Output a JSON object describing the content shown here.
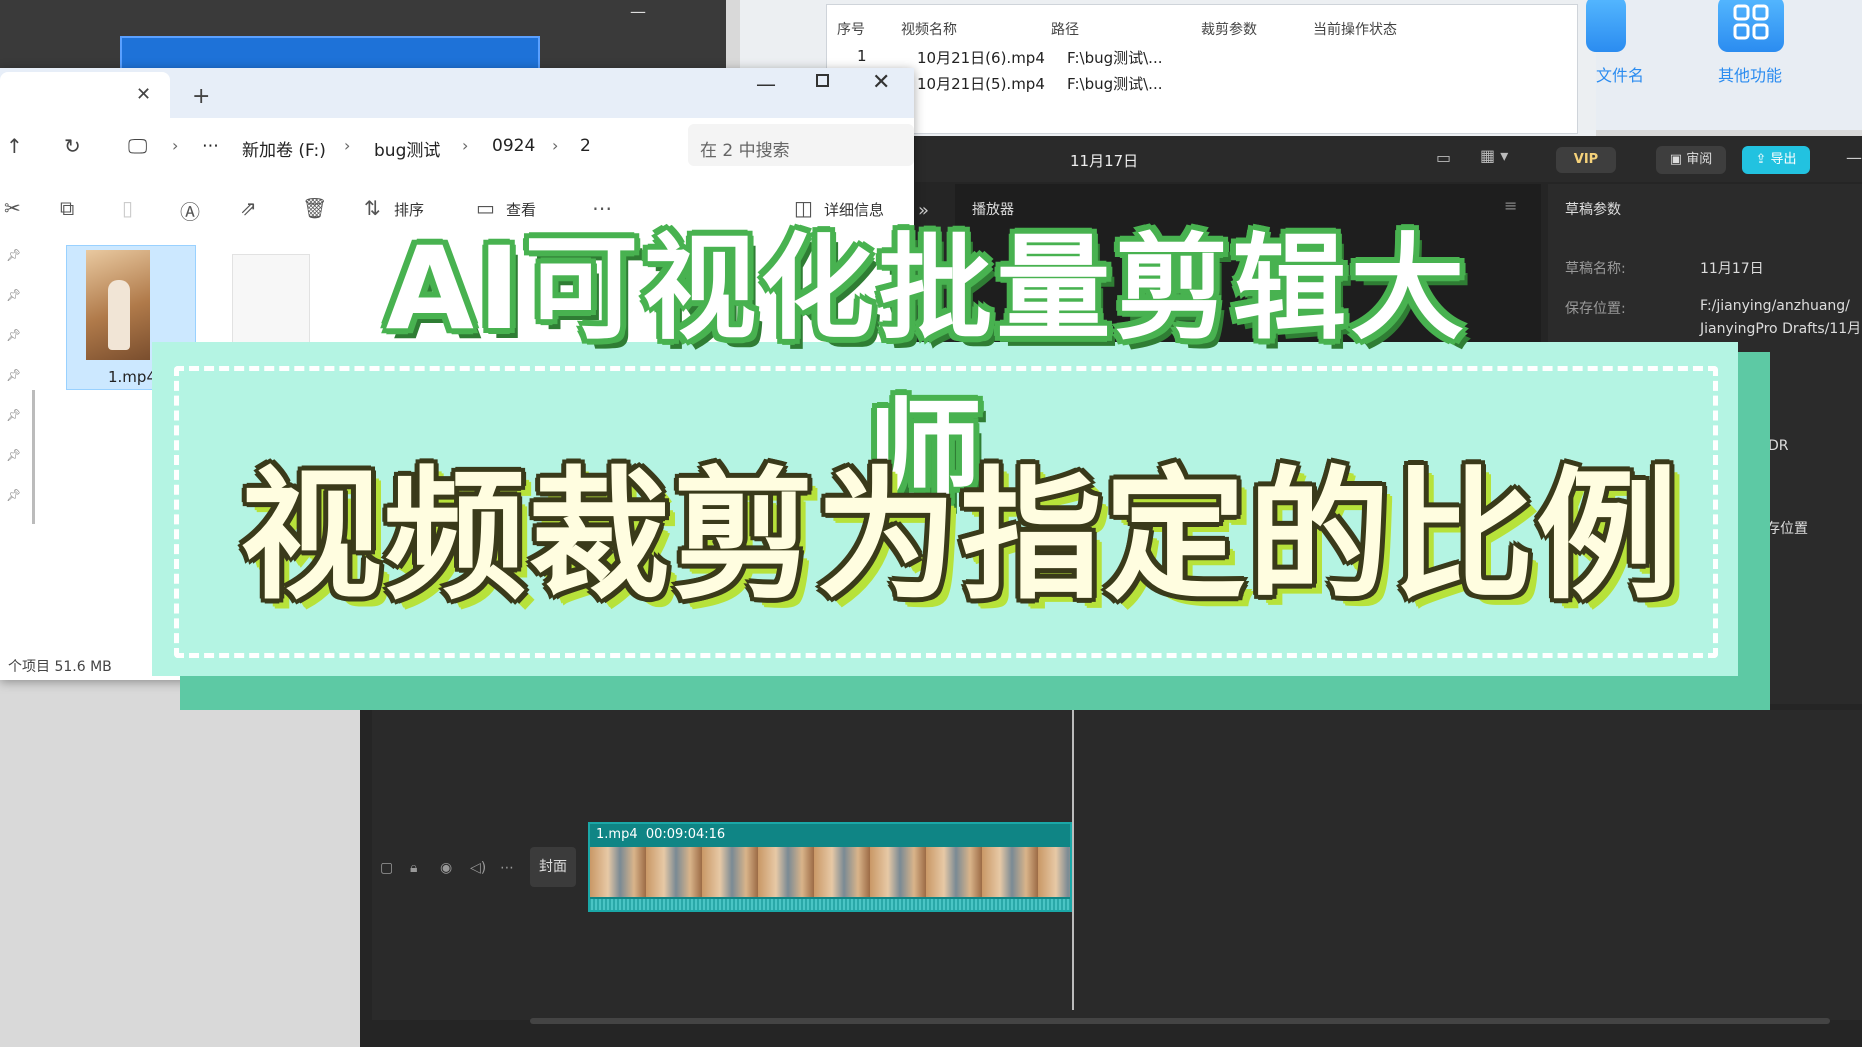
{
  "batch_table": {
    "headers": [
      "序号",
      "视频名称",
      "路径",
      "裁剪参数",
      "当前操作状态"
    ],
    "rows": [
      {
        "index": "1",
        "name": "10月21日(6).mp4",
        "path": "F:\\bug测试\\..."
      },
      {
        "index": "",
        "name": "10月21日(5).mp4",
        "path": "F:\\bug测试\\..."
      }
    ]
  },
  "tools": {
    "rename_label": "文件名",
    "other_label": "其他功能"
  },
  "editor": {
    "title": "11月17日",
    "vip_label": "VIP",
    "review_label": "审阅",
    "export_label": "导出",
    "player_label": "播放器",
    "params_title": "草稿参数",
    "params": [
      {
        "key": "草稿名称:",
        "value": "11月17日"
      },
      {
        "key": "保存位置:",
        "value": "F:/jianying/anzhuang/"
      },
      {
        "key": "",
        "value": "JianyingPro Drafts/11月"
      }
    ],
    "params_partial": [
      "DR",
      "存位置"
    ],
    "cover_label": "封面",
    "clip": {
      "name": "1.mp4",
      "duration": "00:09:04:16"
    }
  },
  "explorer": {
    "path": [
      "新加卷 (F:)",
      "bug测试",
      "0924",
      "2"
    ],
    "search_placeholder": "在 2 中搜索",
    "commands": {
      "sort": "排序",
      "view": "查看",
      "details": "详细信息"
    },
    "file": {
      "name": "1.mp4"
    },
    "status": "个项目 51.6 MB"
  },
  "overlay": {
    "headline": "AI可视化批量剪辑大师",
    "subline": "视频裁剪为指定的比例"
  },
  "colors": {
    "banner": "#b4f4e3",
    "banner_shadow": "#5dc9a4",
    "headline_outline": "#48b250",
    "export_accent": "#22c2e0",
    "explorer_selection": "#cce8ff"
  }
}
